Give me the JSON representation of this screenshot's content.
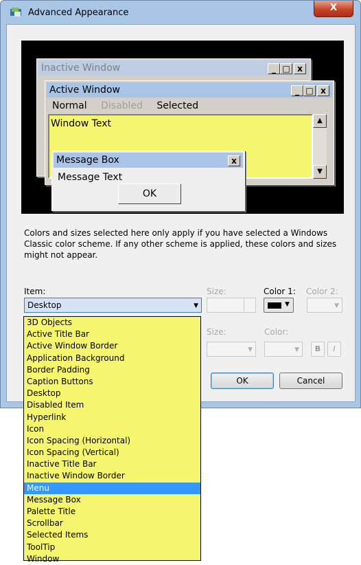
{
  "window": {
    "title": "Advanced Appearance",
    "close_label": "X"
  },
  "preview": {
    "inactive_title": "Inactive Window",
    "active_title": "Active Window",
    "menu_normal": "Normal",
    "menu_disabled": "Disabled",
    "menu_selected": "Selected",
    "window_text": "Window Text",
    "msgbox_title": "Message Box",
    "msgbox_close": "x",
    "msgbox_text": "Message Text",
    "ok_label": "OK",
    "caption_buttons": [
      "_",
      "□",
      "x"
    ]
  },
  "description": "Colors and sizes selected here only apply if you have selected a Windows Classic color scheme. If any other scheme is applied, these colors and sizes might not appear.",
  "controls": {
    "item_label": "Item:",
    "item_value": "Desktop",
    "size_label": "Size:",
    "color1_label": "Color 1:",
    "color2_label": "Color 2:",
    "font_size_label": "Size:",
    "font_color_label": "Color:",
    "bold_label": "B",
    "italic_label": "I",
    "color1_value": "#000000"
  },
  "buttons": {
    "ok": "OK",
    "cancel": "Cancel"
  },
  "dropdown": {
    "items": [
      "3D Objects",
      "Active Title Bar",
      "Active Window Border",
      "Application Background",
      "Border Padding",
      "Caption Buttons",
      "Desktop",
      "Disabled Item",
      "Hyperlink",
      "Icon",
      "Icon Spacing (Horizontal)",
      "Icon Spacing (Vertical)",
      "Inactive Title Bar",
      "Inactive Window Border",
      "Menu",
      "Message Box",
      "Palette Title",
      "Scrollbar",
      "Selected Items",
      "ToolTip",
      "Window"
    ],
    "highlighted": "Menu"
  },
  "colors": {
    "preview_background": "#000000",
    "window_background": "#f5f56e",
    "highlight": "#3399ff",
    "active_title": "#a9c4e6",
    "inactive_title": "#bfcde4"
  }
}
